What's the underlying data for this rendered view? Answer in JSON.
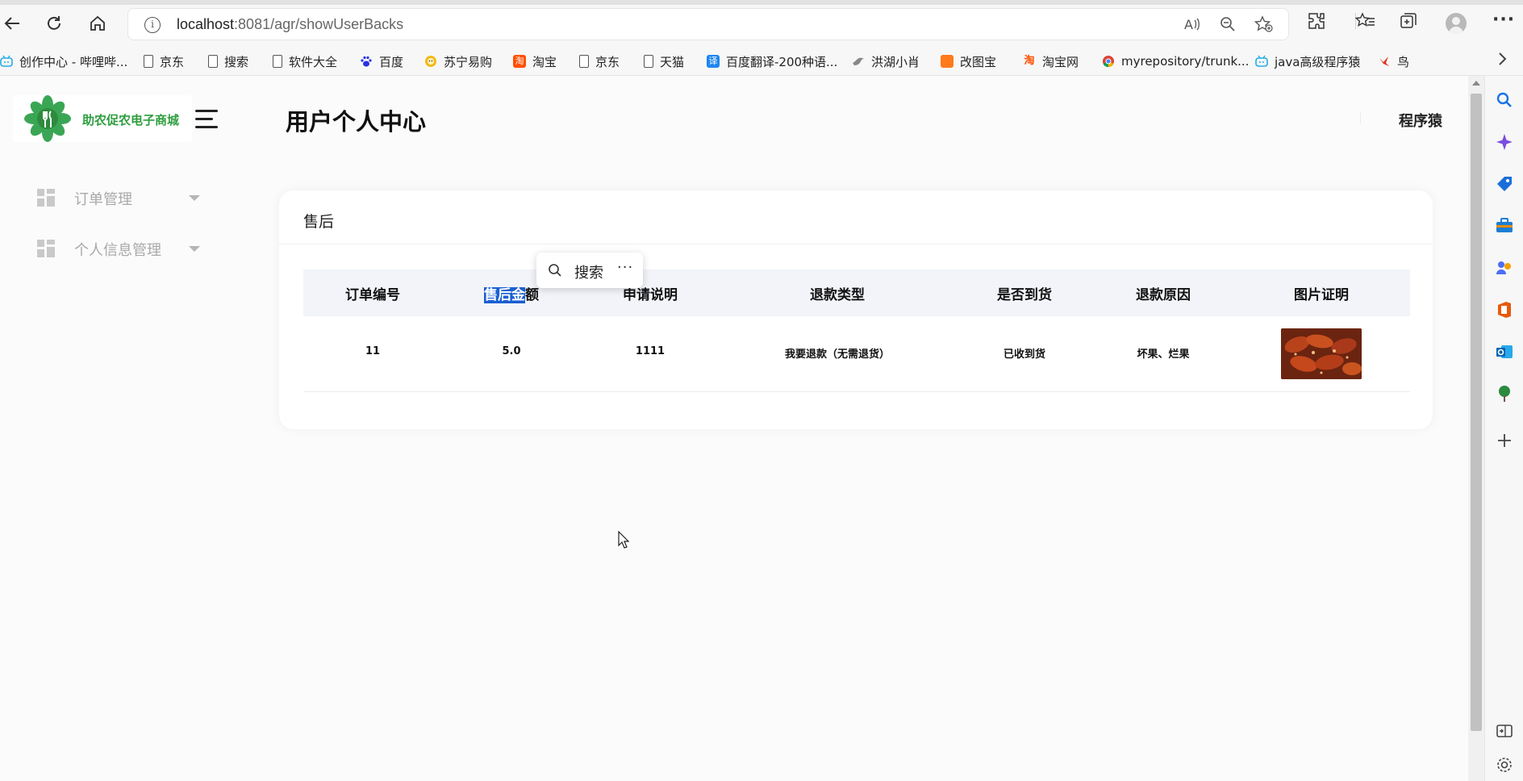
{
  "browser": {
    "url_host": "localhost",
    "url_rest": ":8081/agr/showUserBacks",
    "icons": [
      "back-arrow",
      "reload",
      "home",
      "info",
      "read-aloud",
      "zoom-out",
      "add-favorite",
      "extensions",
      "favorites",
      "collections",
      "profile",
      "more"
    ]
  },
  "bookmarks": [
    {
      "label": "创作中心 - 哔哩哔...",
      "icon": "bilibili",
      "color": "#23ade5"
    },
    {
      "label": "京东",
      "icon": "doc"
    },
    {
      "label": "搜索",
      "icon": "doc"
    },
    {
      "label": "软件大全",
      "icon": "doc"
    },
    {
      "label": "百度",
      "icon": "baidu",
      "color": "#2932e1"
    },
    {
      "label": "苏宁易购",
      "icon": "suning",
      "color": "#f6b918"
    },
    {
      "label": "淘宝",
      "icon": "taobao",
      "color": "#ff5000"
    },
    {
      "label": "京东",
      "icon": "doc"
    },
    {
      "label": "天猫",
      "icon": "doc"
    },
    {
      "label": "百度翻译-200种语...",
      "icon": "translate",
      "color": "#1e86f0"
    },
    {
      "label": "洪湖小肖",
      "icon": "bird",
      "color": "#888888"
    },
    {
      "label": "改图宝",
      "icon": "gaitubao",
      "color": "#ff7a1a"
    },
    {
      "label": "淘宝网",
      "icon": "taobao",
      "color": "#ff5000"
    },
    {
      "label": "myrepository/trunk...",
      "icon": "chrome",
      "color": "#db4437"
    },
    {
      "label": "java高级程序猿",
      "icon": "bilibili",
      "color": "#23ade5"
    },
    {
      "label": "鸟",
      "icon": "bird-red",
      "color": "#e0301e"
    }
  ],
  "app": {
    "logo_text": "助农促农电子商城",
    "page_title": "用户个人中心",
    "user_name": "程序猿",
    "brand_color": "#2e9e3f"
  },
  "sidebar": {
    "items": [
      {
        "label": "订单管理",
        "icon": "dashboard-grid-icon"
      },
      {
        "label": "个人信息管理",
        "icon": "dashboard-grid-icon"
      }
    ]
  },
  "card": {
    "title": "售后"
  },
  "table": {
    "headers": [
      "订单编号",
      "售后金额",
      "申请说明",
      "退款类型",
      "是否到货",
      "退款原因",
      "图片证明"
    ],
    "selected_header_part": "售后金",
    "selected_header_rest": "额",
    "rows": [
      {
        "order_no": "11",
        "amount": "5.0",
        "description": "1111",
        "refund_type": "我要退款（无需退货）",
        "arrived": "已收到货",
        "reason": "坏果、烂果",
        "image": "food-photo"
      }
    ]
  },
  "selection_popup": {
    "label": "搜索",
    "more": "···"
  }
}
